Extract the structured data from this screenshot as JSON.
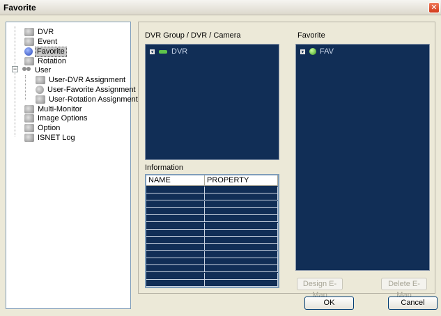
{
  "window": {
    "title": "Favorite",
    "close_glyph": "✕"
  },
  "tree": {
    "items": [
      {
        "label": "DVR",
        "icon": "dvr-icon"
      },
      {
        "label": "Event",
        "icon": "event-icon"
      },
      {
        "label": "Favorite",
        "icon": "globe-icon",
        "selected": true
      },
      {
        "label": "Rotation",
        "icon": "rotation-icon"
      },
      {
        "label": "User",
        "icon": "users-icon",
        "expanded": true
      },
      {
        "label": "User-DVR Assignment",
        "icon": "dvr-assign-icon"
      },
      {
        "label": "User-Favorite Assignment",
        "icon": "favorite-assign-icon"
      },
      {
        "label": "User-Rotation Assignment",
        "icon": "rotation-assign-icon"
      },
      {
        "label": "Multi-Monitor",
        "icon": "monitor-icon"
      },
      {
        "label": "Image Options",
        "icon": "image-options-icon"
      },
      {
        "label": "Option",
        "icon": "option-icon"
      },
      {
        "label": "ISNET Log",
        "icon": "log-icon"
      }
    ],
    "user_expander_glyph": "−"
  },
  "dvr_panel": {
    "label": "DVR Group / DVR / Camera",
    "root": {
      "label": "DVR"
    }
  },
  "favorite_panel": {
    "label": "Favorite",
    "root": {
      "label": "FAV"
    }
  },
  "info": {
    "label": "Information",
    "columns": [
      "NAME",
      "PROPERTY"
    ]
  },
  "buttons": {
    "design_emap": "Design E-Map",
    "delete_emap": "Delete E-Map",
    "ok": "OK",
    "cancel": "Cancel"
  },
  "colors": {
    "panel_bg": "#112e56",
    "dialog_bg": "#ece9d8"
  }
}
